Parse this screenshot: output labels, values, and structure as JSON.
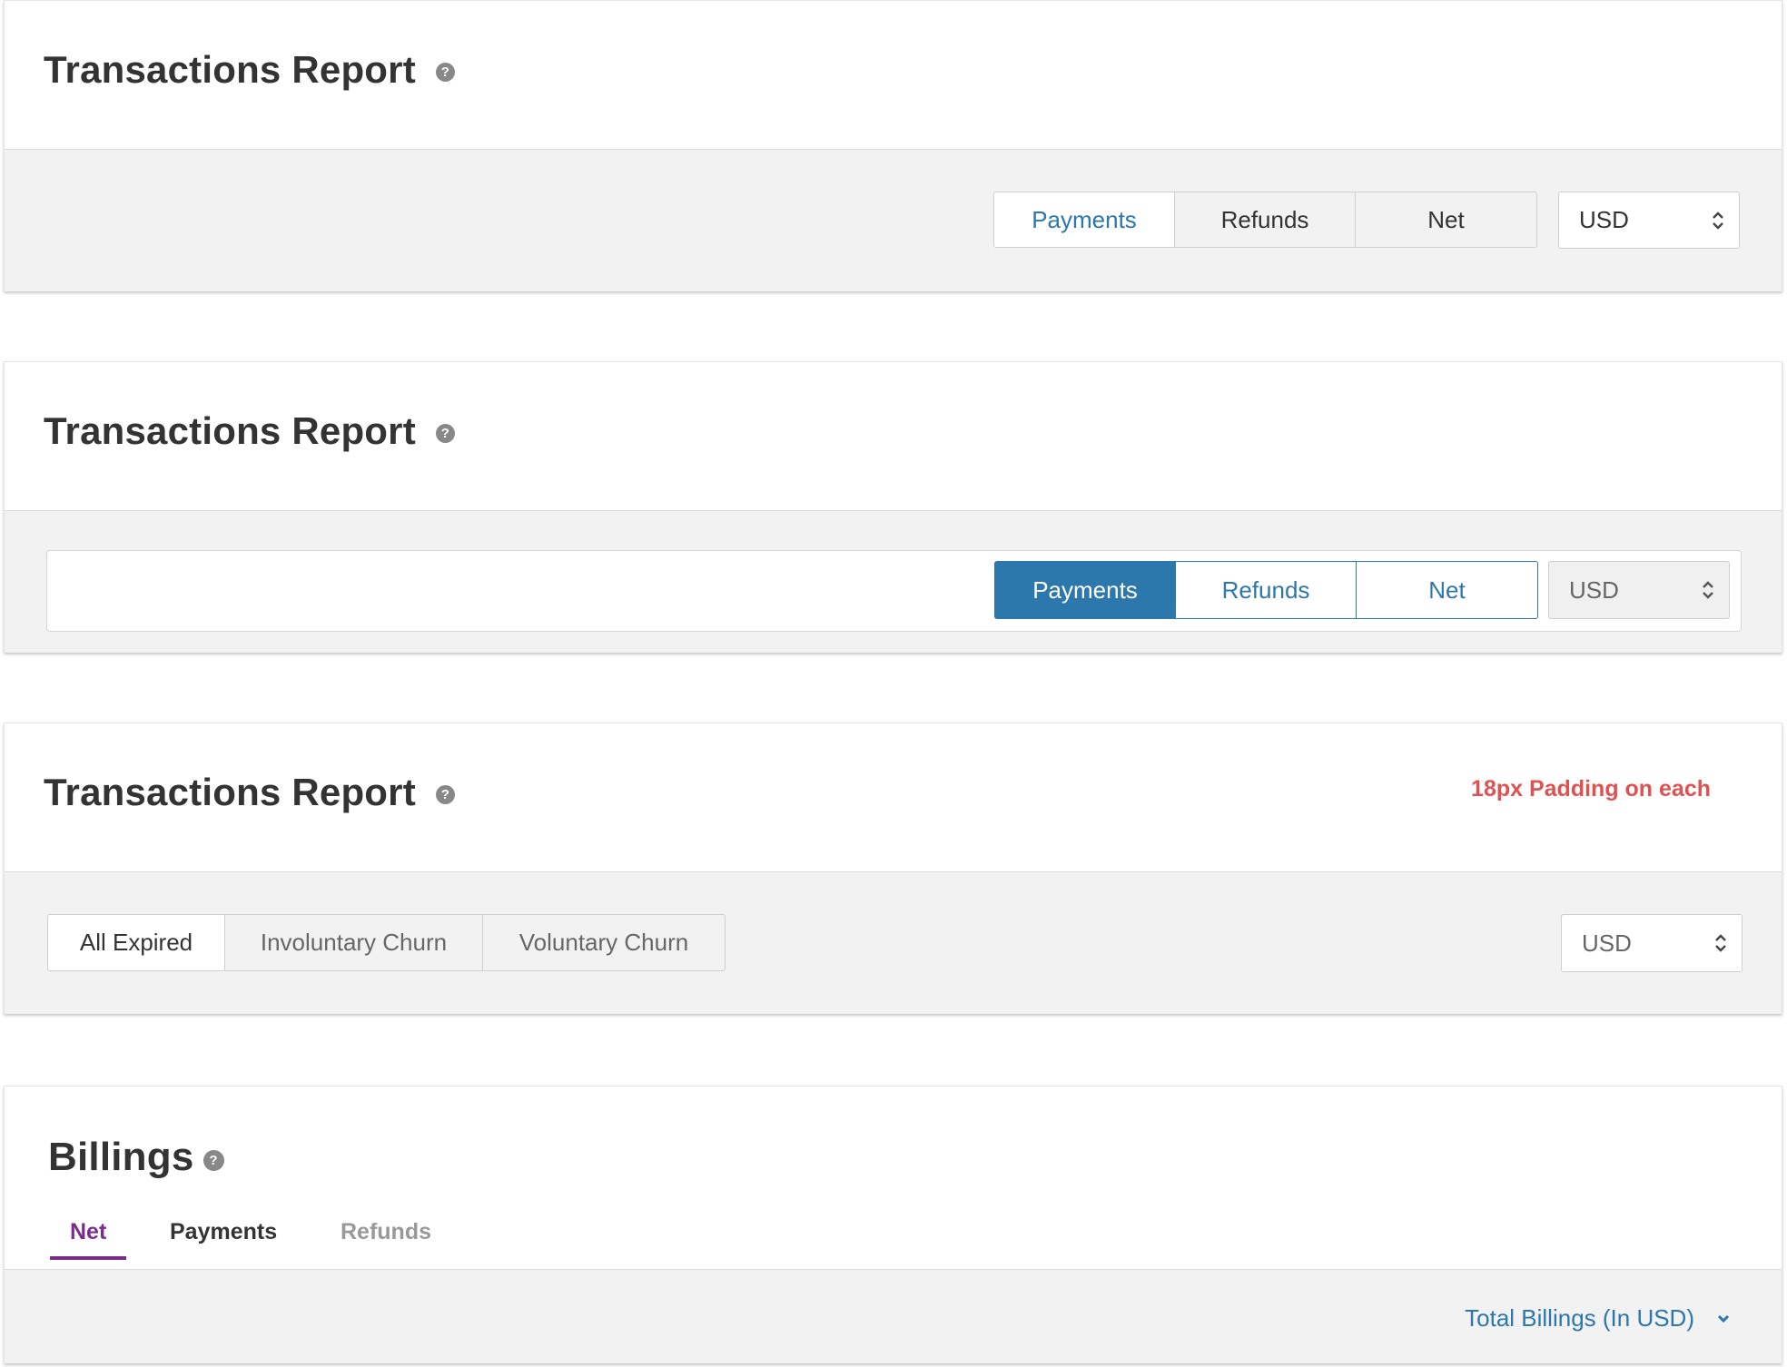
{
  "colors": {
    "accent_blue": "#2c77ab",
    "accent_purple": "#7b2d8e",
    "note_red": "#e05252",
    "toolbar_bg": "#f2f2f2"
  },
  "card1": {
    "title": "Transactions Report",
    "help_icon": "?",
    "segments": [
      "Payments",
      "Refunds",
      "Net"
    ],
    "selected_segment": "Payments",
    "currency": "USD"
  },
  "card2": {
    "title": "Transactions Report",
    "help_icon": "?",
    "segments": [
      "Payments",
      "Refunds",
      "Net"
    ],
    "selected_segment": "Payments",
    "currency": "USD"
  },
  "card3": {
    "title": "Transactions Report",
    "help_icon": "?",
    "note": "18px Padding on each",
    "segments": [
      "All Expired",
      "Involuntary Churn",
      "Voluntary Churn"
    ],
    "selected_segment": "All Expired",
    "currency": "USD"
  },
  "card4": {
    "title": "Billings",
    "help_icon": "?",
    "tabs": [
      "Net",
      "Payments",
      "Refunds"
    ],
    "active_tab": "Net",
    "totals_label": "Total Billings (In USD)",
    "totals_icon": "chevron-down-icon"
  }
}
